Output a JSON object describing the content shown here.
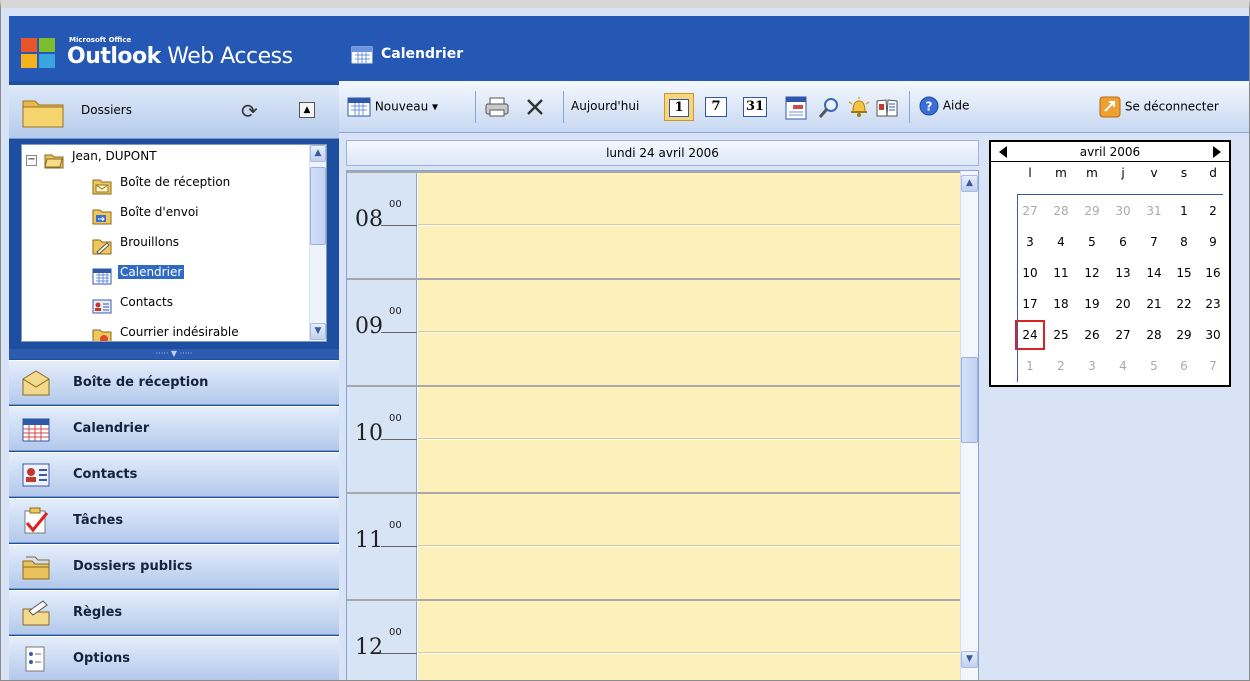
{
  "app": {
    "brand_small": "Microsoft Office",
    "brand_name_bold": "Outlook",
    "brand_name_rest": " Web Access"
  },
  "left": {
    "folders_label": "Dossiers",
    "tree": {
      "user": "Jean, DUPONT",
      "items": [
        {
          "label": "Boîte de réception",
          "icon": "inbox-icon"
        },
        {
          "label": "Boîte d'envoi",
          "icon": "outbox-icon"
        },
        {
          "label": "Brouillons",
          "icon": "drafts-icon"
        },
        {
          "label": "Calendrier",
          "icon": "calendar-icon",
          "selected": true
        },
        {
          "label": "Contacts",
          "icon": "contacts-icon"
        },
        {
          "label": "Courrier indésirable",
          "icon": "junk-mail-icon"
        }
      ]
    },
    "nav": [
      {
        "label": "Boîte de réception",
        "icon": "inbox-icon"
      },
      {
        "label": "Calendrier",
        "icon": "calendar-icon"
      },
      {
        "label": "Contacts",
        "icon": "contacts-icon"
      },
      {
        "label": "Tâches",
        "icon": "tasks-icon"
      },
      {
        "label": "Dossiers publics",
        "icon": "public-folders-icon"
      },
      {
        "label": "Règles",
        "icon": "rules-icon"
      },
      {
        "label": "Options",
        "icon": "options-icon"
      }
    ]
  },
  "header": {
    "title": "Calendrier"
  },
  "toolbar": {
    "new_label": "Nouveau",
    "today_label": "Aujourd'hui",
    "day_view_label": "1",
    "week_view_label": "7",
    "month_view_label": "31",
    "help_label": "Aide",
    "logout_label": "Se déconnecter"
  },
  "day_view": {
    "date_label": "lundi 24 avril 2006",
    "hours": [
      {
        "hour": "08",
        "min": "00"
      },
      {
        "hour": "09",
        "min": "00"
      },
      {
        "hour": "10",
        "min": "00"
      },
      {
        "hour": "11",
        "min": "00"
      },
      {
        "hour": "12",
        "min": "00"
      }
    ]
  },
  "mini_calendar": {
    "month_label": "avril 2006",
    "weekdays": [
      "l",
      "m",
      "m",
      "j",
      "v",
      "s",
      "d"
    ],
    "weeks": [
      [
        "27",
        "28",
        "29",
        "30",
        "31",
        "1",
        "2"
      ],
      [
        "3",
        "4",
        "5",
        "6",
        "7",
        "8",
        "9"
      ],
      [
        "10",
        "11",
        "12",
        "13",
        "14",
        "15",
        "16"
      ],
      [
        "17",
        "18",
        "19",
        "20",
        "21",
        "22",
        "23"
      ],
      [
        "24",
        "25",
        "26",
        "27",
        "28",
        "29",
        "30"
      ],
      [
        "1",
        "2",
        "3",
        "4",
        "5",
        "6",
        "7"
      ]
    ],
    "other_month": [
      [
        0,
        0
      ],
      [
        0,
        1
      ],
      [
        0,
        2
      ],
      [
        0,
        3
      ],
      [
        0,
        4
      ],
      [
        5,
        0
      ],
      [
        5,
        1
      ],
      [
        5,
        2
      ],
      [
        5,
        3
      ],
      [
        5,
        4
      ],
      [
        5,
        5
      ],
      [
        5,
        6
      ]
    ],
    "today": [
      4,
      0
    ]
  },
  "colors": {
    "header_blue": "#2458b4",
    "selection": "#316ac5",
    "slot_yellow": "#fdf0ba",
    "today_border": "#d22222"
  }
}
